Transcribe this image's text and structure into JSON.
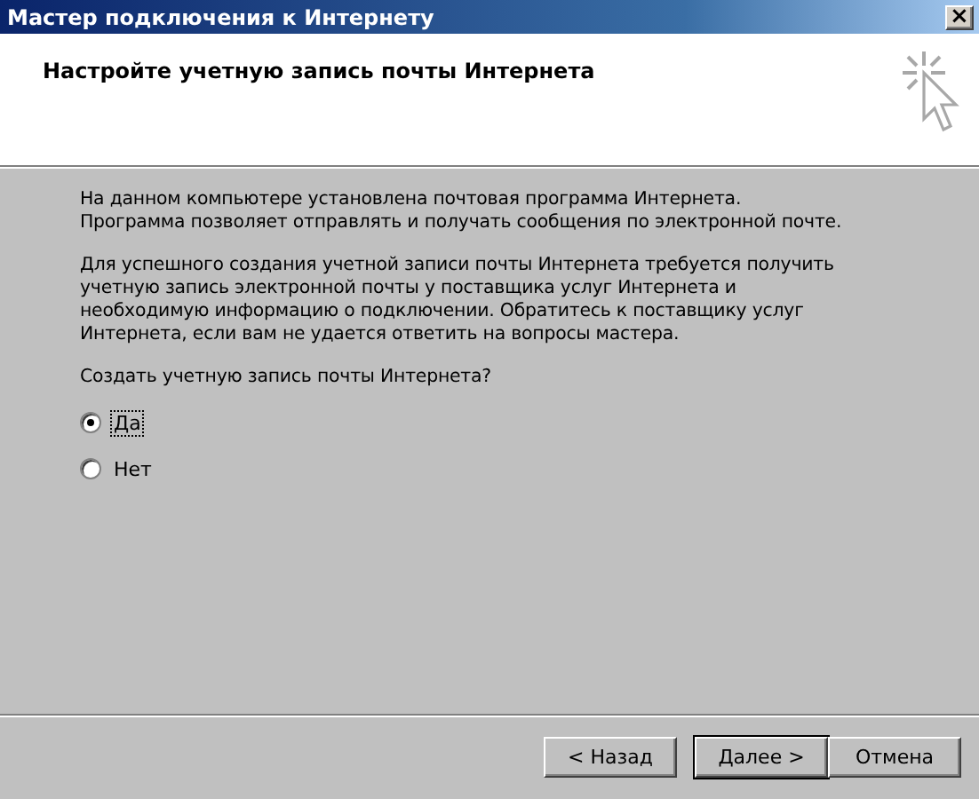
{
  "window": {
    "title": "Мастер подключения к Интернету",
    "close": "×"
  },
  "header": {
    "title": "Настройте учетную запись почты Интернета"
  },
  "paragraphs": [
    "На данном компьютере установлена почтовая программа Интернета.\nПрограмма позволяет отправлять и получать сообщения по электронной почте.",
    "Для успешного создания учетной записи почты Интернета требуется получить\nучетную запись электронной почты у поставщика услуг Интернета и\nнеобходимую информацию о подключении. Обратитесь к поставщику услуг\nИнтернета, если вам не удается ответить на вопросы мастера."
  ],
  "question": "Создать учетную запись почты Интернета?",
  "options": [
    {
      "label": "Да",
      "selected": true,
      "focused": true
    },
    {
      "label": "Нет",
      "selected": false,
      "focused": false
    }
  ],
  "buttons": [
    {
      "label": "< Назад",
      "default": false
    },
    {
      "label": "Далее >",
      "default": true
    },
    {
      "label": "Отмена",
      "default": false
    }
  ]
}
